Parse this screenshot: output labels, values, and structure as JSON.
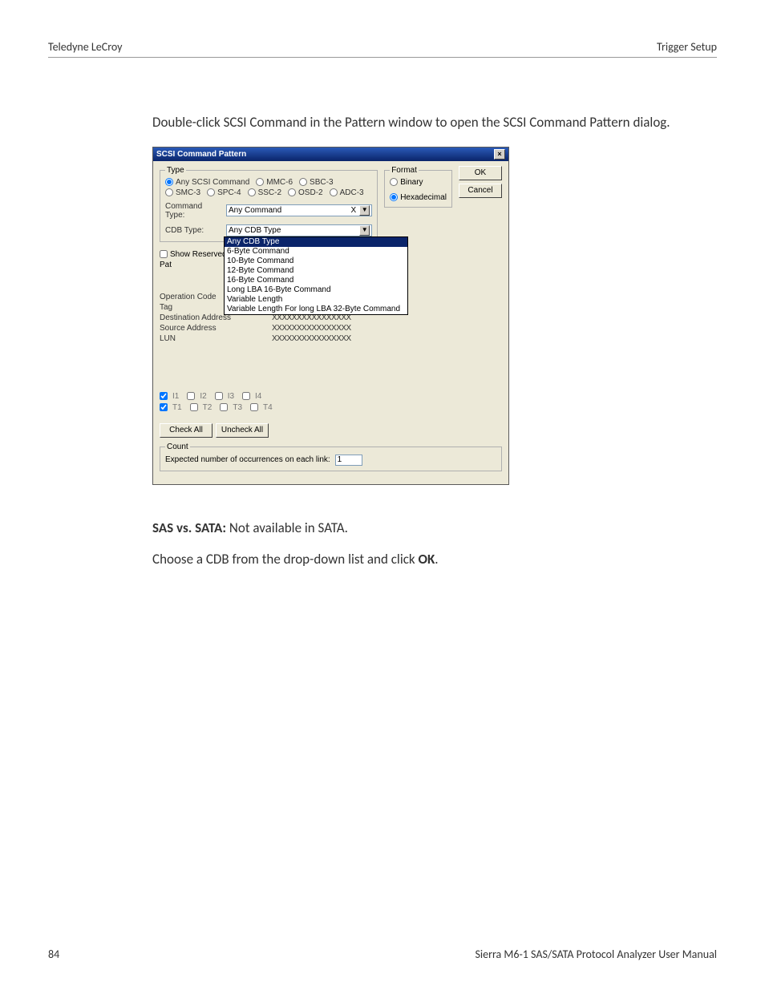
{
  "header": {
    "left": "Teledyne LeCroy",
    "right": "Trigger Setup"
  },
  "intro": "Double-click SCSI Command in the Pattern window to open the SCSI Command Pattern dialog.",
  "dialog": {
    "title": "SCSI Command Pattern",
    "type_legend": "Type",
    "type_options": [
      "Any SCSI Command",
      "MMC-6",
      "SBC-3",
      "SMC-3",
      "SPC-4",
      "SSC-2",
      "OSD-2",
      "ADC-3"
    ],
    "type_selected": "Any SCSI Command",
    "cmd_type_label": "Command Type:",
    "cmd_type_value": "Any Command",
    "cmd_type_x": "X",
    "cdb_type_label": "CDB Type:",
    "cdb_type_value": "Any CDB Type",
    "cdb_options": [
      "Any CDB Type",
      "6-Byte Command",
      "10-Byte Command",
      "12-Byte Command",
      "16-Byte Command",
      "Long LBA 16-Byte Command",
      "Variable Length",
      "Variable Length For long LBA 32-Byte Command"
    ],
    "show_reserved": "Show Reserved",
    "pattern_label": "Pat",
    "params": [
      {
        "label": "Operation Code",
        "value": ""
      },
      {
        "label": "Tag",
        "value": ""
      },
      {
        "label": "Destination Address",
        "value": "XXXXXXXXXXXXXXXX"
      },
      {
        "label": "Source Address",
        "value": "XXXXXXXXXXXXXXXX"
      },
      {
        "label": "LUN",
        "value": "XXXXXXXXXXXXXXXX"
      }
    ],
    "links_row1": [
      "I1",
      "I2",
      "I3",
      "I4"
    ],
    "links_row2": [
      "T1",
      "T2",
      "T3",
      "T4"
    ],
    "check_all": "Check All",
    "uncheck_all": "Uncheck All",
    "count_legend": "Count",
    "count_label": "Expected number of occurrences on each link:",
    "count_value": "1",
    "format_legend": "Format",
    "format_options": [
      "Binary",
      "Hexadecimal"
    ],
    "format_selected": "Hexadecimal",
    "ok": "OK",
    "cancel": "Cancel"
  },
  "post": {
    "sas_label": "SAS vs. SATA:",
    "sas_text": " Not available in SATA.",
    "choose_prefix": "Choose a CDB from the drop-down list and click ",
    "choose_bold": "OK",
    "choose_suffix": "."
  },
  "footer": {
    "page": "84",
    "manual": "Sierra M6-1 SAS/SATA Protocol Analyzer User Manual"
  }
}
